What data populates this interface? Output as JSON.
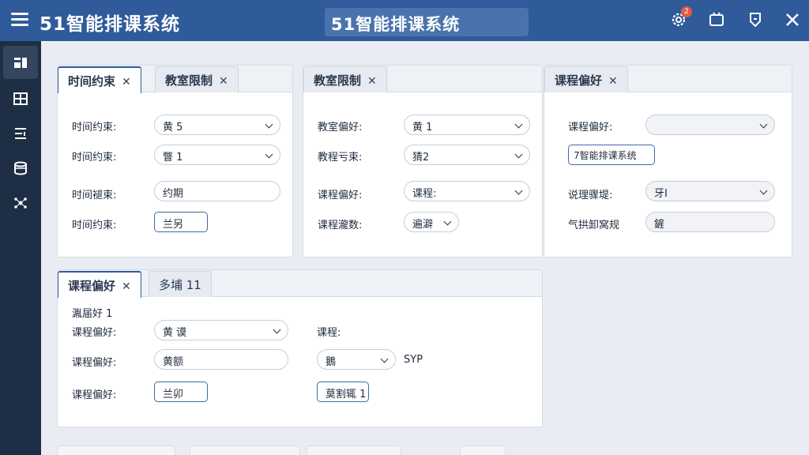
{
  "app": {
    "title": "51智能排课系统",
    "center_title": "51智能排课系统",
    "notification_count": "2"
  },
  "panel1": {
    "tabs": [
      {
        "label": "时间约束",
        "close": "✕"
      },
      {
        "label": "教室限制",
        "close": "✕"
      }
    ],
    "rows": [
      {
        "label": "时间约束:",
        "value": "黄  5"
      },
      {
        "label": "时间约束:",
        "value": "瞥 1"
      },
      {
        "label": "时间褪束:",
        "value": "约期"
      },
      {
        "label": "时间约束:",
        "value": "兰另"
      }
    ]
  },
  "panel2": {
    "tabs": [
      {
        "label": "教室限制",
        "close": "✕"
      }
    ],
    "rows": [
      {
        "label": "教室偏好:",
        "value": "黄  1"
      },
      {
        "label": "教程亏束:",
        "value": "猜2"
      },
      {
        "label": "课程偏好:",
        "value": "课程:"
      },
      {
        "label": "课程瀧数:",
        "value": "遍澼"
      }
    ]
  },
  "panel3": {
    "tabs": [
      {
        "label": "课程偏好",
        "close": "✕"
      }
    ],
    "rows": [
      {
        "label": "课程偏好:",
        "value": ""
      },
      {
        "label": "",
        "value": "7智能排课系统"
      },
      {
        "label": "说理骤堤:",
        "value": "牙Ⅰ"
      },
      {
        "label": "气拱卸窝规",
        "value": "鏟"
      }
    ]
  },
  "panel4": {
    "tabs": [
      {
        "label": "课程偏好",
        "close": "✕"
      },
      {
        "label": "多埔 11",
        "close": ""
      }
    ],
    "header_note": "湚届好 1",
    "rows": [
      {
        "label": "课程偏好:",
        "value": "黄  谟"
      },
      {
        "label": "课程偏好:",
        "value": "黄额"
      },
      {
        "label": "课程偏好:",
        "value": "兰卯"
      }
    ],
    "right_label": "课程:",
    "right_select": "鵝",
    "right_suffix": "SYP",
    "right_button": "莫割辄 1"
  },
  "icons": {
    "menu": "hamburger-menu-icon",
    "top_right": [
      "settings-gear-icon",
      "window-icon",
      "shield-icon",
      "close-icon"
    ],
    "sidebar": [
      "dashboard-icon",
      "schedule-icon",
      "rules-icon",
      "database-icon",
      "network-icon"
    ]
  }
}
